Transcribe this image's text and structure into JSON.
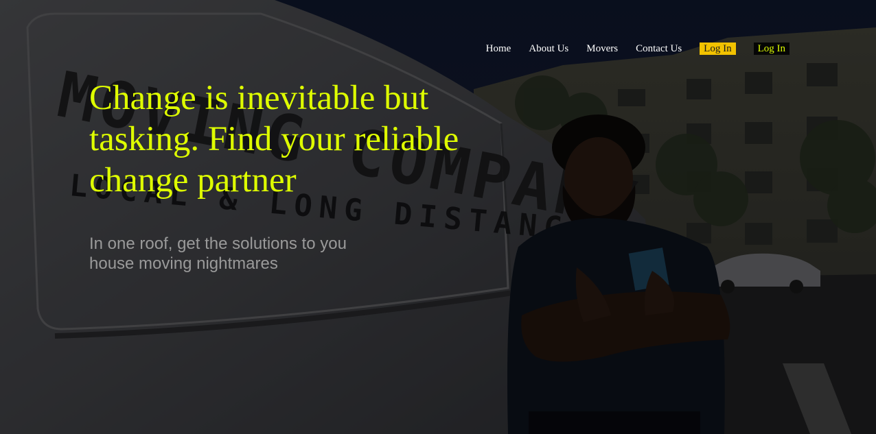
{
  "nav": {
    "items": [
      {
        "label": "Home"
      },
      {
        "label": "About Us"
      },
      {
        "label": "Movers"
      },
      {
        "label": "Contact Us"
      }
    ],
    "login_primary": "Log In",
    "login_secondary": "Log In"
  },
  "hero": {
    "headline": "Change is inevitable but tasking. Find your reliable change partner",
    "subheadline": "In one roof, get the solutions to you house moving nightmares",
    "van_text_line1": "MOVING COMPANY",
    "van_text_line2": "LOCAL & LONG DISTANCE"
  },
  "colors": {
    "accent": "#dfff00",
    "login_bg": "#f2c200",
    "background": "#15192a",
    "subtext": "#9a9a9a"
  }
}
